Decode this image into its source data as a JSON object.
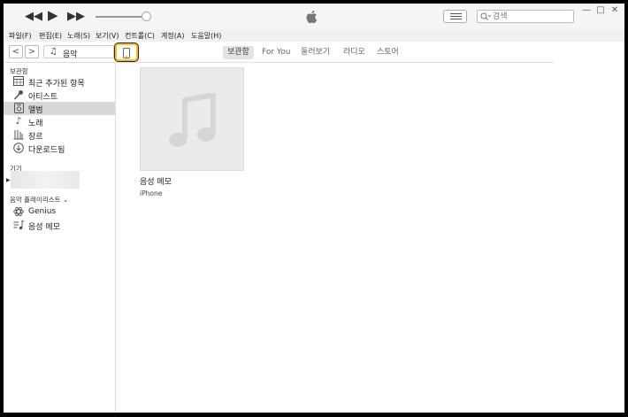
{
  "titlebar": {
    "prev_icon": "rewind-icon",
    "play_icon": "play-icon",
    "next_icon": "fast-forward-icon",
    "volume_level": 0.85,
    "list_view_icon": "list-view-icon",
    "search": {
      "value": "",
      "placeholder": "검색"
    },
    "window_controls": {
      "minimize": "—",
      "maximize": "□",
      "close": "✕"
    }
  },
  "menu": [
    "파일(F)",
    "편집(E)",
    "노래(S)",
    "보기(V)",
    "컨트롤(C)",
    "계정(A)",
    "도움말(H)"
  ],
  "navbar": {
    "back": "<",
    "forward": ">",
    "media_kind": "음악",
    "tabs": [
      "보관함",
      "For You",
      "둘러보기",
      "라디오",
      "스토어"
    ],
    "active_tab": "보관함"
  },
  "sidebar": {
    "library_heading": "보관함",
    "library_items": [
      {
        "label": "최근 추가된 항목",
        "icon": "calendar-grid-icon"
      },
      {
        "label": "아티스트",
        "icon": "microphone-icon"
      },
      {
        "label": "앨범",
        "icon": "album-icon",
        "selected": true
      },
      {
        "label": "노래",
        "icon": "music-note-icon"
      },
      {
        "label": "장르",
        "icon": "guitar-icon"
      },
      {
        "label": "다운로드됨",
        "icon": "download-icon"
      }
    ],
    "devices_heading": "기기",
    "playlists_heading": "음악 플레이리스트 ⌄",
    "playlist_items": [
      {
        "label": "Genius",
        "icon": "genius-atom-icon"
      },
      {
        "label": "음성 메모",
        "icon": "playlist-note-icon"
      }
    ]
  },
  "main": {
    "albums": [
      {
        "title": "음성 메모",
        "subtitle": "iPhone",
        "art_icon": "music-note-icon"
      }
    ]
  },
  "colors": {
    "highlight_border": "#f0c419",
    "selected_row": "#d8d8d8",
    "tab_active": "#e3e3e3"
  }
}
